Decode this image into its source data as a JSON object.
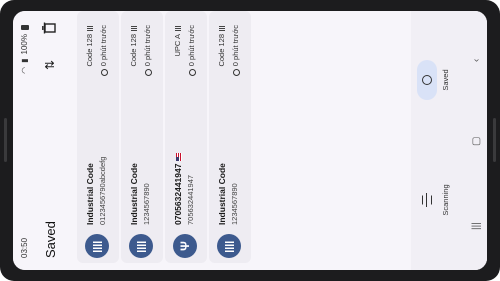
{
  "status_bar": {
    "time": "03:50",
    "battery": "100%"
  },
  "app_bar": {
    "title": "Saved"
  },
  "items": [
    {
      "title": "Industrial Code",
      "value": "0123456790abcdefg",
      "format": "Code 128",
      "time": "0 phút trước",
      "icon": "barcode-icon",
      "flag": false
    },
    {
      "title": "Industrial Code",
      "value": "1234567890",
      "format": "Code 128",
      "time": "0 phút trước",
      "icon": "barcode-icon",
      "flag": false
    },
    {
      "title": "070563244194​7",
      "value": "705632441947",
      "format": "UPC A",
      "time": "0 phút trước",
      "icon": "fork-knife-icon",
      "flag": true
    },
    {
      "title": "Industrial Code",
      "value": "1234567890",
      "format": "Code 128",
      "time": "0 phút trước",
      "icon": "barcode-icon",
      "flag": false
    }
  ],
  "bottom_nav": {
    "scanning_label": "Scanning",
    "saved_label": "Saved"
  }
}
